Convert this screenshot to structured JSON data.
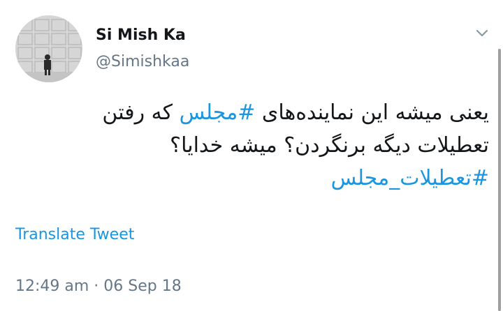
{
  "author": {
    "name": "Si Mish Ka",
    "handle": "@Simishkaa"
  },
  "icons": {
    "menu": "chevron-down-icon",
    "avatar": "profile-photo"
  },
  "tweet": {
    "line1_before": "یعنی میشه این نماینده‌های ",
    "line1_hashtag": "#مجلس",
    "line1_after": " که رفتن",
    "line2": "تعطیلات دیگه برنگردن؟ میشه خدایا؟",
    "line3_hashtag": "#تعطیلات_مجلس"
  },
  "translate_label": "Translate Tweet",
  "timestamp": "12:49 am · 06 Sep 18",
  "colors": {
    "link": "#1b95e0",
    "text": "#14171a",
    "muted": "#657786"
  }
}
